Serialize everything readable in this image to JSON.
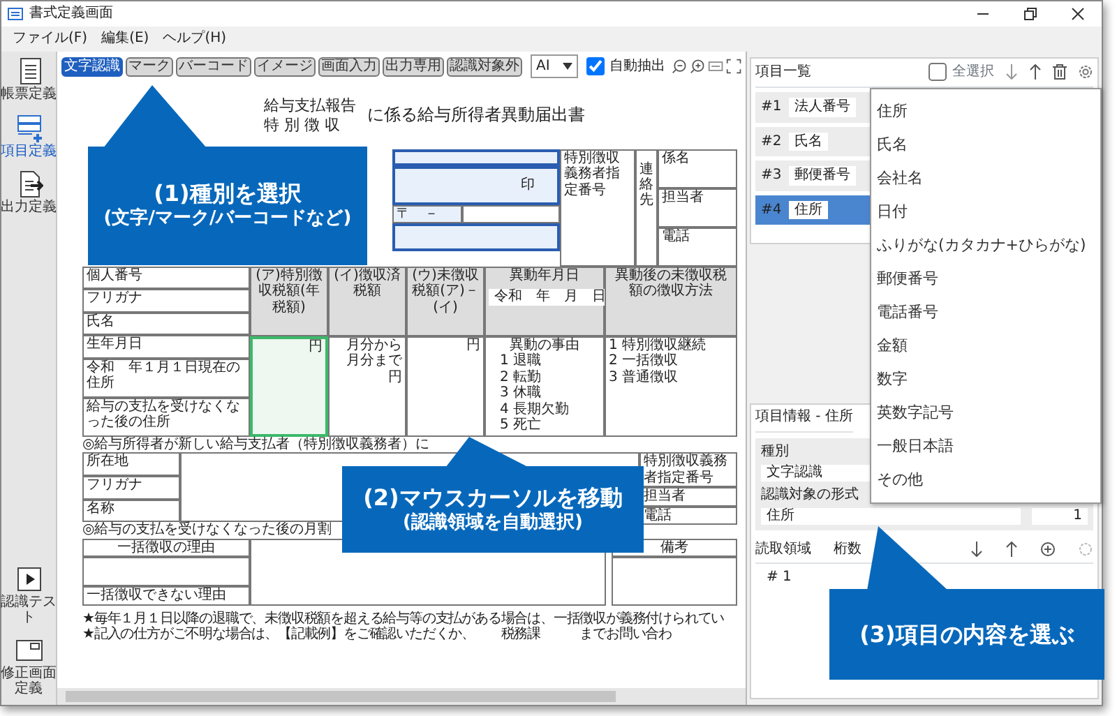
{
  "window": {
    "title": "書式定義画面"
  },
  "menu": [
    "ファイル(F)",
    "編集(E)",
    "ヘルプ(H)"
  ],
  "sidebar": {
    "items": [
      {
        "label": "帳票定義",
        "selected": false
      },
      {
        "label": "項目定義",
        "selected": true
      },
      {
        "label": "出力定義",
        "selected": false
      }
    ],
    "bottom_items": [
      {
        "label": "認識テスト"
      },
      {
        "label": "修正画面定義"
      }
    ]
  },
  "toolbar": {
    "type_buttons": [
      {
        "label": "文字認識",
        "selected": true
      },
      {
        "label": "マーク",
        "selected": false
      },
      {
        "label": "バーコード",
        "selected": false
      },
      {
        "label": "イメージ",
        "selected": false
      },
      {
        "label": "画面入力",
        "selected": false
      },
      {
        "label": "出力専用",
        "selected": false
      },
      {
        "label": "認識対象外",
        "selected": false
      }
    ],
    "engine": {
      "value": "AI"
    },
    "auto_extract": {
      "label": "自動抽出",
      "checked": true
    }
  },
  "document": {
    "title_lines": [
      "給与支払報告",
      "特 別 徴 収"
    ],
    "title_suffix": "に係る給与所得者異動届出書",
    "seal_mark": "印",
    "postal_mark": "〒　－",
    "employer": {
      "code_label": "特別徴収義務者指定番号",
      "contact_label": "連絡先",
      "contact_rows": [
        "係名",
        "担当者",
        "電話"
      ]
    },
    "person_labels": [
      "個人番号",
      "フリガナ",
      "氏名",
      "生年月日",
      "令和　年１月１日現在の住所",
      "給与の支払を受けなくなった後の住所"
    ],
    "tax_columns": [
      {
        "heading": "(ア)",
        "label": "特別徴収税額(年税額)",
        "highlighted": true,
        "lines": [
          "円"
        ]
      },
      {
        "heading": "(イ)",
        "label": "徴収済税額",
        "highlighted": false,
        "lines": [
          "月分から",
          "月分まで",
          "円"
        ]
      },
      {
        "heading": "(ウ)",
        "label": "未徴収税額(ア)－(イ)",
        "highlighted": false,
        "lines": [
          "円"
        ]
      }
    ],
    "change": {
      "date_label": "異動年月日",
      "date_value": "令和　年　月　日",
      "reason_label": "異動の事由",
      "reasons": [
        "1 退職",
        "2 転勤",
        "3 休職",
        "4 長期欠勤",
        "5 死亡"
      ]
    },
    "method": {
      "label": "異動後の未徴収税額の徴収方法",
      "options": [
        "1 特別徴収継続",
        "2 一括徴収",
        "3 普通徴収"
      ]
    },
    "new_employer": {
      "note": "◎給与所得者が新しい給与支払者（特別徴収義務者）に",
      "labels": [
        "所在地",
        "フリガナ",
        "名称"
      ],
      "right_labels": [
        "特別徴収義務者指定番号",
        "担当者",
        "電話"
      ]
    },
    "lump_sum": {
      "note": "◎給与の支払を受けなくなった後の月割",
      "reason_label": "一括徴収の理由",
      "remarks_label": "備考",
      "unable_label": "一括徴収できない理由"
    },
    "footer_notes": [
      "★毎年１月１日以降の退職で、未徴収税額を超える給与等の支払がある場合は、一括徴収が義務付けられてい",
      "★記入の仕方がご不明な場合は、【記載例】をご確認いただくか、　　税務課　　　までお問い合わ"
    ]
  },
  "item_list": {
    "title": "項目一覧",
    "select_all": {
      "label": "全選択",
      "checked": false
    },
    "items": [
      {
        "number": "#1",
        "name": "法人番号",
        "selected": false
      },
      {
        "number": "#2",
        "name": "氏名",
        "selected": false
      },
      {
        "number": "#3",
        "name": "郵便番号",
        "selected": false
      },
      {
        "number": "#4",
        "name": "住所",
        "selected": true
      }
    ]
  },
  "item_info": {
    "title": "項目情報 - 住所",
    "type_label": "種別",
    "type_value": "文字認識",
    "format_label": "認識対象の形式",
    "format_value": "住所",
    "count_value": "1",
    "region_columns": [
      "読取領域",
      "桁数"
    ],
    "region_rows": [
      {
        "number": "# 1"
      }
    ]
  },
  "dropdown": {
    "options": [
      "住所",
      "氏名",
      "会社名",
      "日付",
      "ふりがな(カタカナ+ひらがな)",
      "郵便番号",
      "電話番号",
      "金額",
      "数字",
      "英数字記号",
      "一般日本語",
      "その他"
    ]
  },
  "callouts": [
    {
      "title": "(1)種別を選択",
      "subtitle": "(文字/マーク/バーコードなど)"
    },
    {
      "title": "(2)マウスカーソルを移動",
      "subtitle": "(認識領域を自動選択)"
    },
    {
      "title": "(3)項目の内容を選ぶ"
    }
  ]
}
